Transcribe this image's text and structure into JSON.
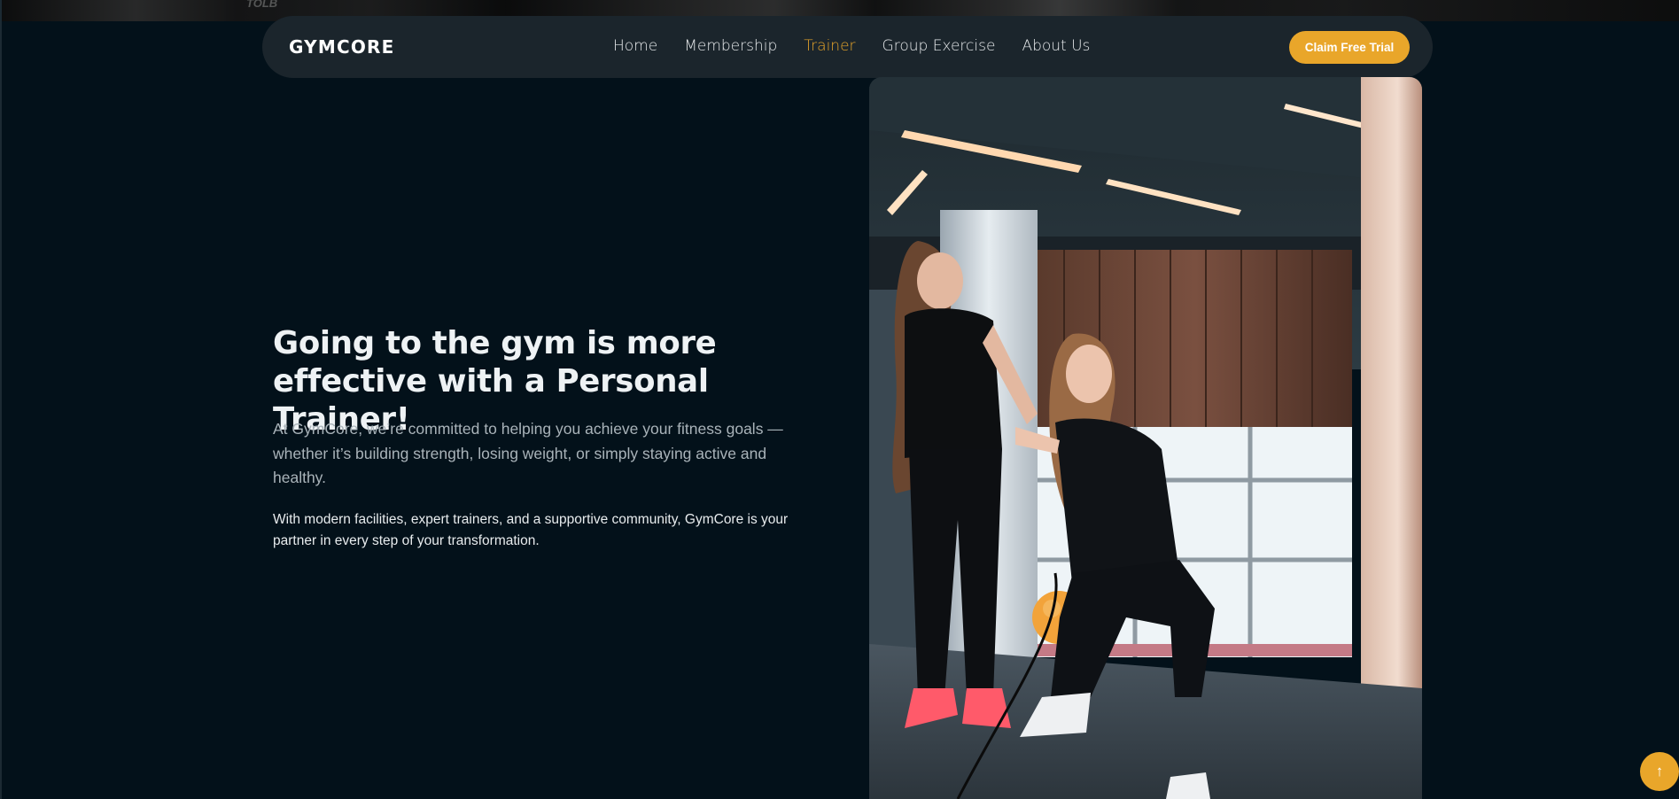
{
  "header": {
    "logo": "GYMCORE",
    "nav": [
      {
        "label": "Home",
        "active": false
      },
      {
        "label": "Membership",
        "active": false
      },
      {
        "label": "Trainer",
        "active": true
      },
      {
        "label": "Group Exercise",
        "active": false
      },
      {
        "label": "About Us",
        "active": false
      }
    ],
    "cta_label": "Claim Free Trial"
  },
  "top_strip": {
    "sign_text": "TOLB"
  },
  "hero": {
    "title": "Going to the gym is more effective with a Personal Trainer!",
    "lead": "At GymCore, we’re committed to helping you achieve your fitness goals — whether it’s building strength, losing weight, or simply staying active and healthy.",
    "body": "With modern facilities, expert trainers, and a supportive community, GymCore is your partner in every step of your transformation.",
    "image_icon": "trainer-photo"
  },
  "scroll_top": {
    "icon": "arrow-up-icon",
    "glyph": "↑"
  },
  "colors": {
    "accent": "#e9a62a",
    "background": "#03111a",
    "navbar": "#1b252c",
    "text": "#eef2f4",
    "muted": "#a9b3b9"
  }
}
